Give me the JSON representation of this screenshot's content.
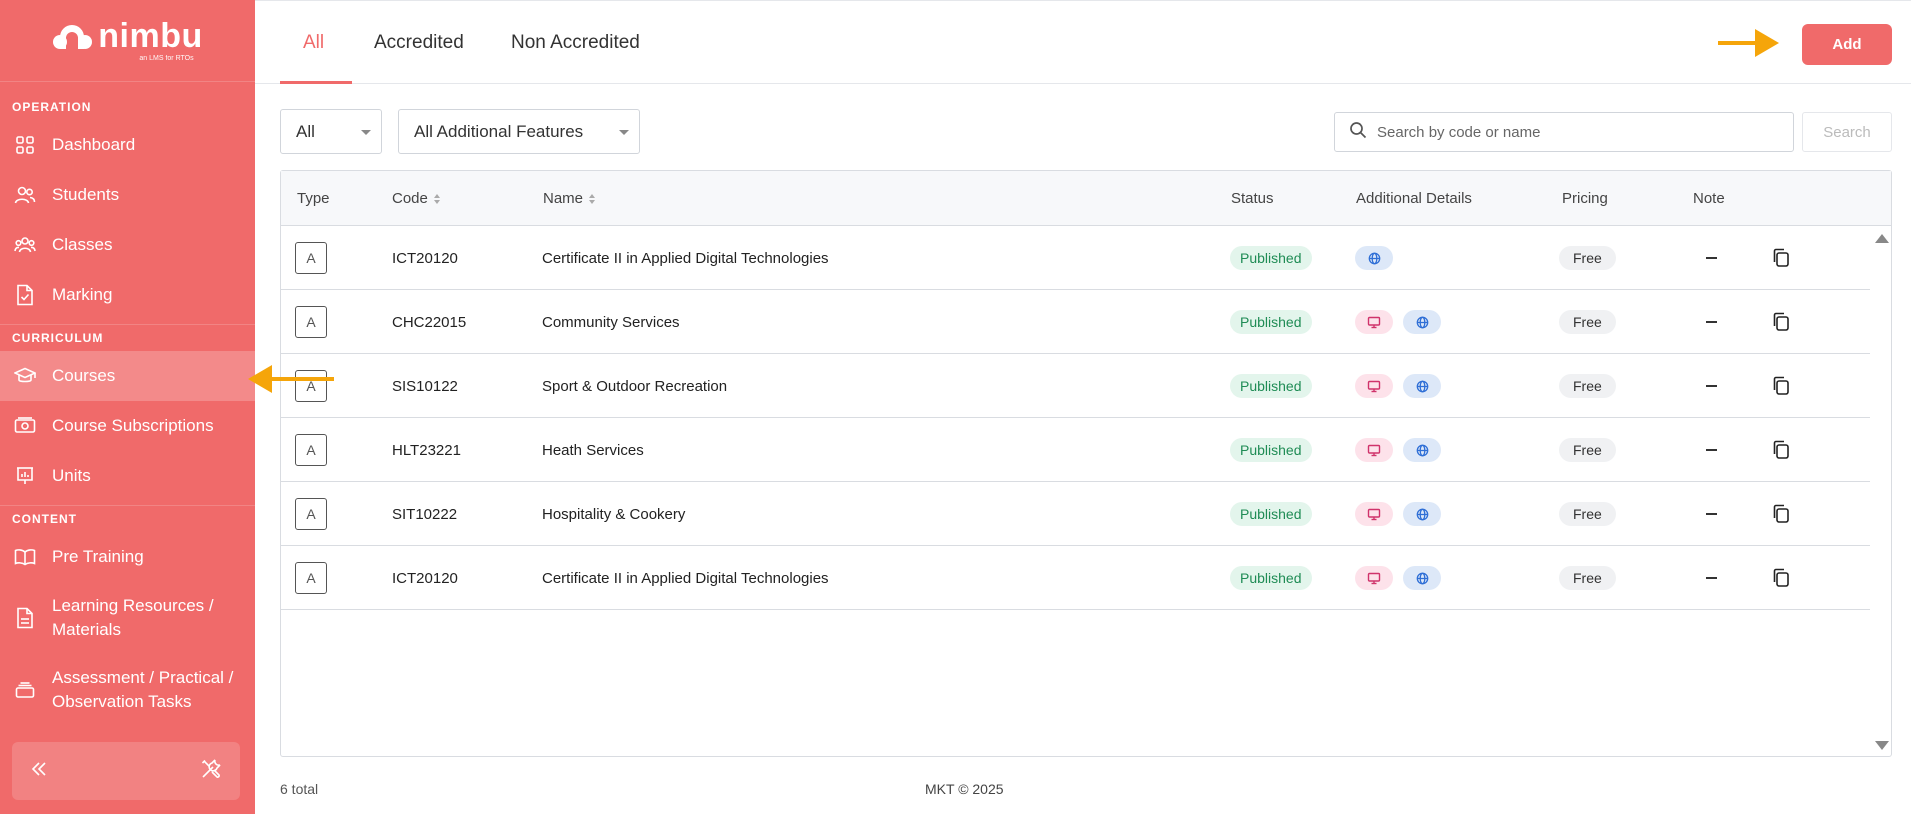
{
  "brand": {
    "name": "nimbu",
    "tagline": "an LMS for RTOs"
  },
  "sidebar": {
    "sections": [
      {
        "label": "OPERATION"
      },
      {
        "label": "CURRICULUM"
      },
      {
        "label": "CONTENT"
      }
    ],
    "items": [
      {
        "label": "Dashboard",
        "icon": "grid-icon"
      },
      {
        "label": "Students",
        "icon": "users-icon"
      },
      {
        "label": "Classes",
        "icon": "group-icon"
      },
      {
        "label": "Marking",
        "icon": "document-check-icon"
      },
      {
        "label": "Courses",
        "icon": "graduation-cap-icon",
        "active": true
      },
      {
        "label": "Course Subscriptions",
        "icon": "money-icon"
      },
      {
        "label": "Units",
        "icon": "presentation-icon"
      },
      {
        "label": "Pre Training",
        "icon": "book-open-icon"
      },
      {
        "label": "Learning Resources / Materials",
        "icon": "file-icon"
      },
      {
        "label": "Assessment / Practical / Observation Tasks",
        "icon": "stack-icon"
      }
    ],
    "footer": {
      "collapse_icon": "double-chevron-left-icon",
      "tools_icon": "tools-icon"
    }
  },
  "tabs": [
    {
      "label": "All",
      "active": true
    },
    {
      "label": "Accredited"
    },
    {
      "label": "Non Accredited"
    }
  ],
  "toolbar": {
    "add_label": "Add",
    "search_label": "Search"
  },
  "filters": {
    "type_value": "All",
    "features_value": "All Additional Features",
    "search_placeholder": "Search by code or name",
    "search_value": ""
  },
  "table": {
    "columns": [
      "Type",
      "Code",
      "Name",
      "Status",
      "Additional Details",
      "Pricing",
      "Note"
    ],
    "rows": [
      {
        "type": "A",
        "code": "ICT20120",
        "name": "Certificate II in Applied Digital Technologies",
        "status": "Published",
        "details": [
          "web"
        ],
        "pricing": "Free",
        "note": "–"
      },
      {
        "type": "A",
        "code": "CHC22015",
        "name": "Community Services",
        "status": "Published",
        "details": [
          "monitor",
          "web"
        ],
        "pricing": "Free",
        "note": "–"
      },
      {
        "type": "A",
        "code": "SIS10122",
        "name": "Sport & Outdoor Recreation",
        "status": "Published",
        "details": [
          "monitor",
          "web"
        ],
        "pricing": "Free",
        "note": "–"
      },
      {
        "type": "A",
        "code": "HLT23221",
        "name": "Heath Services",
        "status": "Published",
        "details": [
          "monitor",
          "web"
        ],
        "pricing": "Free",
        "note": "–"
      },
      {
        "type": "A",
        "code": "SIT10222",
        "name": "Hospitality & Cookery",
        "status": "Published",
        "details": [
          "monitor",
          "web"
        ],
        "pricing": "Free",
        "note": "–"
      },
      {
        "type": "A",
        "code": "ICT20120",
        "name": "Certificate II in Applied Digital Technologies",
        "status": "Published",
        "details": [
          "monitor",
          "web"
        ],
        "pricing": "Free",
        "note": "–"
      }
    ]
  },
  "footer": {
    "total": "6 total",
    "copyright": "MKT © 2025"
  },
  "colors": {
    "brand": "#f06a6a",
    "published_bg": "#e3f5ec",
    "published_text": "#1f8c55",
    "annotation": "#f5a50a"
  }
}
